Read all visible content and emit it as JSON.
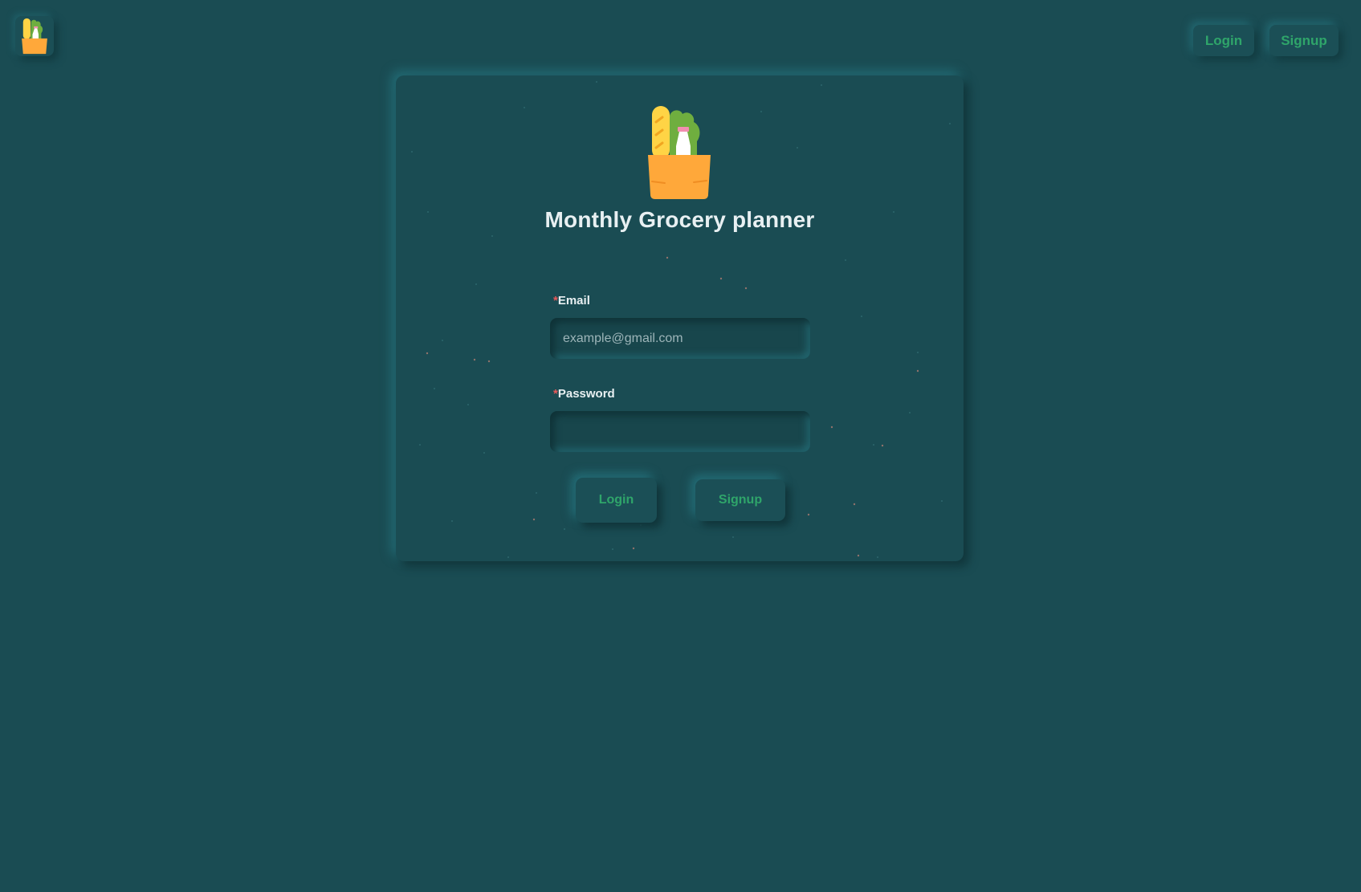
{
  "nav": {
    "logo_icon": "grocery-bag-icon",
    "login_label": "Login",
    "signup_label": "Signup"
  },
  "card": {
    "icon": "grocery-bag-icon",
    "title": "Monthly Grocery planner",
    "email": {
      "required_mark": "*",
      "label": "Email",
      "placeholder": "example@gmail.com",
      "value": ""
    },
    "password": {
      "required_mark": "*",
      "label": "Password",
      "value": ""
    },
    "login_label": "Login",
    "signup_label": "Signup"
  },
  "colors": {
    "background": "#1a4c53",
    "accent_green": "#2fa56a",
    "required_red": "#e8595a",
    "bag_orange": "#ffa83a",
    "bread_yellow": "#ffd445",
    "lettuce_green": "#6fae3f"
  }
}
